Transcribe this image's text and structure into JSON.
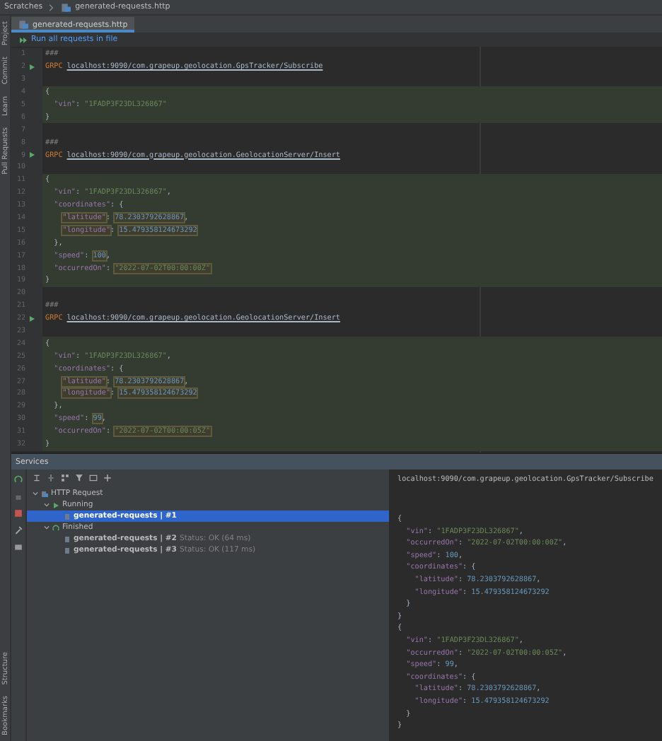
{
  "breadcrumb": [
    "Scratches",
    "generated-requests.http"
  ],
  "tool_strip": {
    "top": [
      "Project",
      "Commit",
      "Learn",
      "Pull Requests"
    ],
    "bottom": [
      "Structure",
      "Bookmarks"
    ]
  },
  "tabs": [
    {
      "label": "generated-requests.http",
      "selected": true
    }
  ],
  "run_all": "Run all requests in file",
  "editor": {
    "lines": [
      {
        "number": "1",
        "run": false,
        "highlight": false,
        "tokens": [
          {
            "kind": "comment",
            "text": "###"
          }
        ]
      },
      {
        "number": "2",
        "run": true,
        "highlight": false,
        "tokens": [
          {
            "kind": "method",
            "text": "GRPC"
          },
          {
            "kind": "url",
            "text": "localhost:9090/com.grapeup.geolocation.GpsTracker/Subscribe"
          }
        ]
      },
      {
        "number": "3",
        "run": false,
        "highlight": false
      },
      {
        "number": "4",
        "run": false,
        "highlight": true,
        "tokens": [
          {
            "kind": "punct",
            "text": "{"
          }
        ]
      },
      {
        "number": "5",
        "run": false,
        "highlight": true,
        "tokens": [
          {
            "kind": "key",
            "text": "  \"vin\""
          },
          {
            "kind": "punct",
            "text": ": "
          },
          {
            "kind": "string",
            "text": "\"1FADP3F23DL326867\""
          }
        ]
      },
      {
        "number": "6",
        "run": false,
        "highlight": true,
        "tokens": [
          {
            "kind": "punct",
            "text": "}"
          }
        ]
      },
      {
        "number": "7",
        "run": false,
        "highlight": false
      },
      {
        "number": "8",
        "run": false,
        "highlight": false,
        "tokens": [
          {
            "kind": "comment",
            "text": "###"
          }
        ]
      },
      {
        "number": "9",
        "run": true,
        "highlight": false,
        "tokens": [
          {
            "kind": "method",
            "text": "GRPC"
          },
          {
            "kind": "url",
            "text": "localhost:9090/com.grapeup.geolocation.GeolocationServer/Insert"
          }
        ]
      },
      {
        "number": "10",
        "run": false,
        "highlight": false
      },
      {
        "number": "11",
        "run": false,
        "highlight": true,
        "tokens": [
          {
            "kind": "punct",
            "text": "{"
          }
        ]
      },
      {
        "number": "12",
        "run": false,
        "highlight": true,
        "tokens": [
          {
            "kind": "key",
            "text": "  \"vin\""
          },
          {
            "kind": "punct",
            "text": ": "
          },
          {
            "kind": "string",
            "text": "\"1FADP3F23DL326867\""
          },
          {
            "kind": "punct",
            "text": ","
          }
        ]
      },
      {
        "number": "13",
        "run": false,
        "highlight": true,
        "tokens": [
          {
            "kind": "key",
            "text": "  \"coordinates\""
          },
          {
            "kind": "punct",
            "text": ": {"
          }
        ]
      },
      {
        "number": "14",
        "run": false,
        "highlight": true,
        "tokens": [
          {
            "kind": "key",
            "text": "    \"latitude\"",
            "boxed": true
          },
          {
            "kind": "punct",
            "text": ": "
          },
          {
            "kind": "number",
            "text": "78.2303792628867",
            "boxed": true
          },
          {
            "kind": "punct",
            "text": ","
          }
        ]
      },
      {
        "number": "15",
        "run": false,
        "highlight": true,
        "tokens": [
          {
            "kind": "key",
            "text": "    \"longitude\"",
            "boxed": true
          },
          {
            "kind": "punct",
            "text": ": "
          },
          {
            "kind": "number",
            "text": "15.479358124673292",
            "boxed": true
          }
        ]
      },
      {
        "number": "16",
        "run": false,
        "highlight": true,
        "tokens": [
          {
            "kind": "punct",
            "text": "  },"
          }
        ]
      },
      {
        "number": "17",
        "run": false,
        "highlight": true,
        "tokens": [
          {
            "kind": "key",
            "text": "  \"speed\""
          },
          {
            "kind": "punct",
            "text": ": "
          },
          {
            "kind": "number",
            "text": "100",
            "boxed": true
          },
          {
            "kind": "punct",
            "text": ","
          }
        ]
      },
      {
        "number": "18",
        "run": false,
        "highlight": true,
        "tokens": [
          {
            "kind": "key",
            "text": "  \"occurredOn\""
          },
          {
            "kind": "punct",
            "text": ": "
          },
          {
            "kind": "string",
            "text": "\"2022-07-02T00:00:00Z\"",
            "boxed": true
          }
        ]
      },
      {
        "number": "19",
        "run": false,
        "highlight": true,
        "tokens": [
          {
            "kind": "punct",
            "text": "}"
          }
        ]
      },
      {
        "number": "20",
        "run": false,
        "highlight": false
      },
      {
        "number": "21",
        "run": false,
        "highlight": false,
        "tokens": [
          {
            "kind": "comment",
            "text": "###"
          }
        ]
      },
      {
        "number": "22",
        "run": true,
        "highlight": false,
        "tokens": [
          {
            "kind": "method",
            "text": "GRPC"
          },
          {
            "kind": "url",
            "text": "localhost:9090/com.grapeup.geolocation.GeolocationServer/Insert"
          }
        ]
      },
      {
        "number": "23",
        "run": false,
        "highlight": false
      },
      {
        "number": "24",
        "run": false,
        "highlight": true,
        "tokens": [
          {
            "kind": "punct",
            "text": "{"
          }
        ]
      },
      {
        "number": "25",
        "run": false,
        "highlight": true,
        "tokens": [
          {
            "kind": "key",
            "text": "  \"vin\""
          },
          {
            "kind": "punct",
            "text": ": "
          },
          {
            "kind": "string",
            "text": "\"1FADP3F23DL326867\""
          },
          {
            "kind": "punct",
            "text": ","
          }
        ]
      },
      {
        "number": "26",
        "run": false,
        "highlight": true,
        "tokens": [
          {
            "kind": "key",
            "text": "  \"coordinates\""
          },
          {
            "kind": "punct",
            "text": ": {"
          }
        ]
      },
      {
        "number": "27",
        "run": false,
        "highlight": true,
        "tokens": [
          {
            "kind": "key",
            "text": "    \"latitude\"",
            "boxed": true
          },
          {
            "kind": "punct",
            "text": ": "
          },
          {
            "kind": "number",
            "text": "78.2303792628867",
            "boxed": true
          },
          {
            "kind": "punct",
            "text": ","
          }
        ]
      },
      {
        "number": "28",
        "run": false,
        "highlight": true,
        "tokens": [
          {
            "kind": "key",
            "text": "    \"longitude\"",
            "boxed": true
          },
          {
            "kind": "punct",
            "text": ": "
          },
          {
            "kind": "number",
            "text": "15.479358124673292",
            "boxed": true
          }
        ]
      },
      {
        "number": "29",
        "run": false,
        "highlight": true,
        "tokens": [
          {
            "kind": "punct",
            "text": "  },"
          }
        ]
      },
      {
        "number": "30",
        "run": false,
        "highlight": true,
        "tokens": [
          {
            "kind": "key",
            "text": "  \"speed\""
          },
          {
            "kind": "punct",
            "text": ": "
          },
          {
            "kind": "number",
            "text": "99",
            "boxed": true
          },
          {
            "kind": "punct",
            "text": ","
          }
        ]
      },
      {
        "number": "31",
        "run": false,
        "highlight": true,
        "tokens": [
          {
            "kind": "key",
            "text": "  \"occurredOn\""
          },
          {
            "kind": "punct",
            "text": ": "
          },
          {
            "kind": "string",
            "text": "\"2022-07-02T00:00:05Z\"",
            "boxed": true
          }
        ]
      },
      {
        "number": "32",
        "run": false,
        "highlight": true,
        "tokens": [
          {
            "kind": "punct",
            "text": "}"
          }
        ]
      }
    ]
  },
  "services": {
    "title": "Services",
    "tree": [
      {
        "label": "HTTP Request",
        "kind": "group",
        "expanded": true,
        "selected": false,
        "children": [
          {
            "label": "Running",
            "kind": "running",
            "expanded": true,
            "selected": false,
            "children": [
              {
                "label": "generated-requests | #1",
                "kind": "request",
                "selected": true
              }
            ]
          },
          {
            "label": "Finished",
            "kind": "finished",
            "expanded": true,
            "selected": false,
            "children": [
              {
                "label": "generated-requests | #2",
                "status": "Status: OK (64 ms)",
                "kind": "request",
                "selected": false
              },
              {
                "label": "generated-requests | #3",
                "status": "Status: OK (117 ms)",
                "kind": "request",
                "selected": false
              }
            ]
          }
        ]
      }
    ],
    "output": {
      "header": "localhost:9090/com.grapeup.geolocation.GpsTracker/Subscribe",
      "lines": [
        [
          {
            "kind": "punct",
            "text": "{"
          }
        ],
        [
          {
            "kind": "key",
            "text": "  \"vin\""
          },
          {
            "kind": "punct",
            "text": ": "
          },
          {
            "kind": "string",
            "text": "\"1FADP3F23DL326867\""
          },
          {
            "kind": "punct",
            "text": ","
          }
        ],
        [
          {
            "kind": "key",
            "text": "  \"occurredOn\""
          },
          {
            "kind": "punct",
            "text": ": "
          },
          {
            "kind": "string",
            "text": "\"2022-07-02T00:00:00Z\""
          },
          {
            "kind": "punct",
            "text": ","
          }
        ],
        [
          {
            "kind": "key",
            "text": "  \"speed\""
          },
          {
            "kind": "punct",
            "text": ": "
          },
          {
            "kind": "number",
            "text": "100"
          },
          {
            "kind": "punct",
            "text": ","
          }
        ],
        [
          {
            "kind": "key",
            "text": "  \"coordinates\""
          },
          {
            "kind": "punct",
            "text": ": {"
          }
        ],
        [
          {
            "kind": "key",
            "text": "    \"latitude\""
          },
          {
            "kind": "punct",
            "text": ": "
          },
          {
            "kind": "number",
            "text": "78.2303792628867"
          },
          {
            "kind": "punct",
            "text": ","
          }
        ],
        [
          {
            "kind": "key",
            "text": "    \"longitude\""
          },
          {
            "kind": "punct",
            "text": ": "
          },
          {
            "kind": "number",
            "text": "15.479358124673292"
          }
        ],
        [
          {
            "kind": "punct",
            "text": "  }"
          }
        ],
        [
          {
            "kind": "punct",
            "text": "}"
          }
        ],
        [
          {
            "kind": "punct",
            "text": "{"
          }
        ],
        [
          {
            "kind": "key",
            "text": "  \"vin\""
          },
          {
            "kind": "punct",
            "text": ": "
          },
          {
            "kind": "string",
            "text": "\"1FADP3F23DL326867\""
          },
          {
            "kind": "punct",
            "text": ","
          }
        ],
        [
          {
            "kind": "key",
            "text": "  \"occurredOn\""
          },
          {
            "kind": "punct",
            "text": ": "
          },
          {
            "kind": "string",
            "text": "\"2022-07-02T00:00:05Z\""
          },
          {
            "kind": "punct",
            "text": ","
          }
        ],
        [
          {
            "kind": "key",
            "text": "  \"speed\""
          },
          {
            "kind": "punct",
            "text": ": "
          },
          {
            "kind": "number",
            "text": "99"
          },
          {
            "kind": "punct",
            "text": ","
          }
        ],
        [
          {
            "kind": "key",
            "text": "  \"coordinates\""
          },
          {
            "kind": "punct",
            "text": ": {"
          }
        ],
        [
          {
            "kind": "key",
            "text": "    \"latitude\""
          },
          {
            "kind": "punct",
            "text": ": "
          },
          {
            "kind": "number",
            "text": "78.2303792628867"
          },
          {
            "kind": "punct",
            "text": ","
          }
        ],
        [
          {
            "kind": "key",
            "text": "    \"longitude\""
          },
          {
            "kind": "punct",
            "text": ": "
          },
          {
            "kind": "number",
            "text": "15.479358124673292"
          }
        ],
        [
          {
            "kind": "punct",
            "text": "  }"
          }
        ],
        [
          {
            "kind": "punct",
            "text": "}"
          }
        ]
      ]
    }
  }
}
